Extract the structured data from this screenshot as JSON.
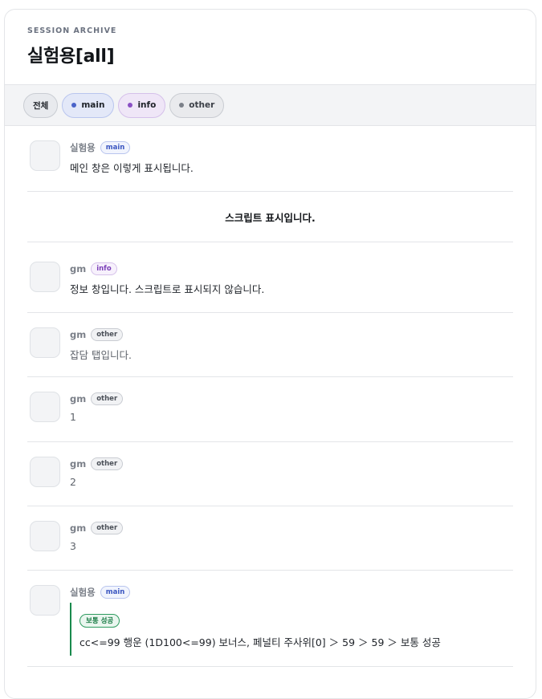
{
  "header": {
    "eyebrow": "SESSION ARCHIVE",
    "title": "실험용[all]"
  },
  "filters": [
    {
      "label": "전체",
      "kind": "all"
    },
    {
      "label": "main",
      "kind": "main",
      "color": "#4a63c9"
    },
    {
      "label": "info",
      "kind": "info",
      "color": "#8a4fc4"
    },
    {
      "label": "other",
      "kind": "other",
      "color": "#7b8089"
    }
  ],
  "messages": [
    {
      "sender": "실험용",
      "tag": "main",
      "text": "메인 창은 이렇게 표시됩니다."
    },
    {
      "script": "스크립트 표시입니다."
    },
    {
      "sender": "gm",
      "tag": "info",
      "text": "정보 창입니다. 스크립트로 표시되지 않습니다."
    },
    {
      "sender": "gm",
      "tag": "other",
      "text": "잡담 탭입니다."
    },
    {
      "sender": "gm",
      "tag": "other",
      "text": "1"
    },
    {
      "sender": "gm",
      "tag": "other",
      "text": "2"
    },
    {
      "sender": "gm",
      "tag": "other",
      "text": "3"
    },
    {
      "sender": "실험용",
      "tag": "main",
      "roll": {
        "result_label": "보통 성공",
        "text": "cc<=99 행운 (1D100<=99) 보너스, 페널티 주사위[0] ＞ 59 ＞ 59 ＞ 보통 성공"
      }
    }
  ]
}
